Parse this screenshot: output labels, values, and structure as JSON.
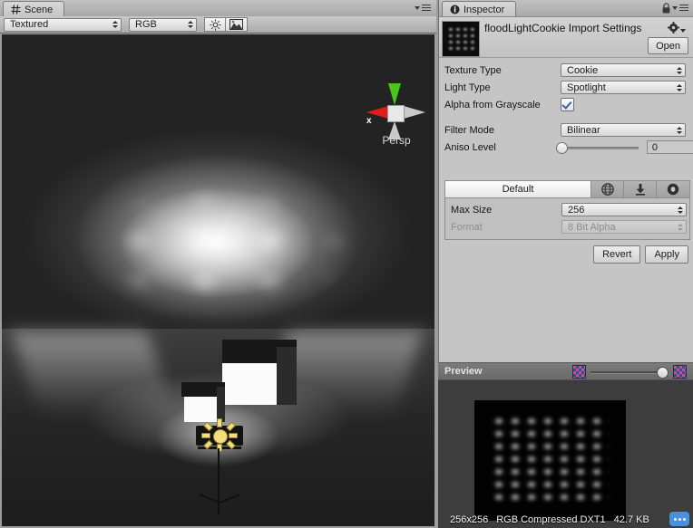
{
  "scene": {
    "tab_label": "Scene",
    "tab_icon": "grid-icon",
    "toolbar": {
      "draw_mode": "Textured",
      "render_mode": "RGB",
      "lighting_icon": "sun-icon",
      "fx_icon": "image-icon"
    },
    "gizmo": {
      "axis_x_label": "x",
      "projection_label": "Persp"
    }
  },
  "inspector": {
    "tab_label": "Inspector",
    "tab_icon": "info-icon",
    "lock_icon": "lock-icon",
    "menu_icon": "hamburger-icon",
    "asset_title": "floodLightCookie Import Settings",
    "gear_icon": "gear-icon",
    "open_label": "Open",
    "properties": [
      {
        "label": "Texture Type",
        "value": "Cookie",
        "kind": "dropdown"
      },
      {
        "label": "Light Type",
        "value": "Spotlight",
        "kind": "dropdown"
      },
      {
        "label": "Alpha from Grayscale",
        "value": "",
        "kind": "checkbox",
        "checked": true
      },
      {
        "label": "Filter Mode",
        "value": "Bilinear",
        "kind": "dropdown"
      },
      {
        "label": "Aniso Level",
        "value": "0",
        "kind": "slider"
      }
    ],
    "platform_tabs": [
      {
        "label": "Default",
        "icon": "",
        "selected": true
      },
      {
        "label": "",
        "icon": "globe-icon",
        "selected": false
      },
      {
        "label": "",
        "icon": "download-icon",
        "selected": false
      },
      {
        "label": "",
        "icon": "circle-icon",
        "selected": false
      }
    ],
    "platform_settings": [
      {
        "label": "Max Size",
        "value": "256",
        "disabled": false
      },
      {
        "label": "Format",
        "value": "8 Bit Alpha",
        "disabled": true
      }
    ],
    "revert_label": "Revert",
    "apply_label": "Apply"
  },
  "preview": {
    "title": "Preview",
    "rgba_icon_left": "rgba-checker-icon",
    "rgba_icon_right": "alpha-checker-icon",
    "info_size": "256x256",
    "info_format": "RGB Compressed DXT1",
    "info_filesize": "42.7 KB",
    "more_icon": "ellipsis-icon"
  },
  "colors": {
    "panel_bg": "#c5c5c5",
    "preview_bg": "#3d3d3d",
    "accent_blue": "#4a8fe0",
    "axis_x": "#e01b1b",
    "axis_y": "#4ac61c",
    "light_yellow": "#f4dd7a"
  }
}
